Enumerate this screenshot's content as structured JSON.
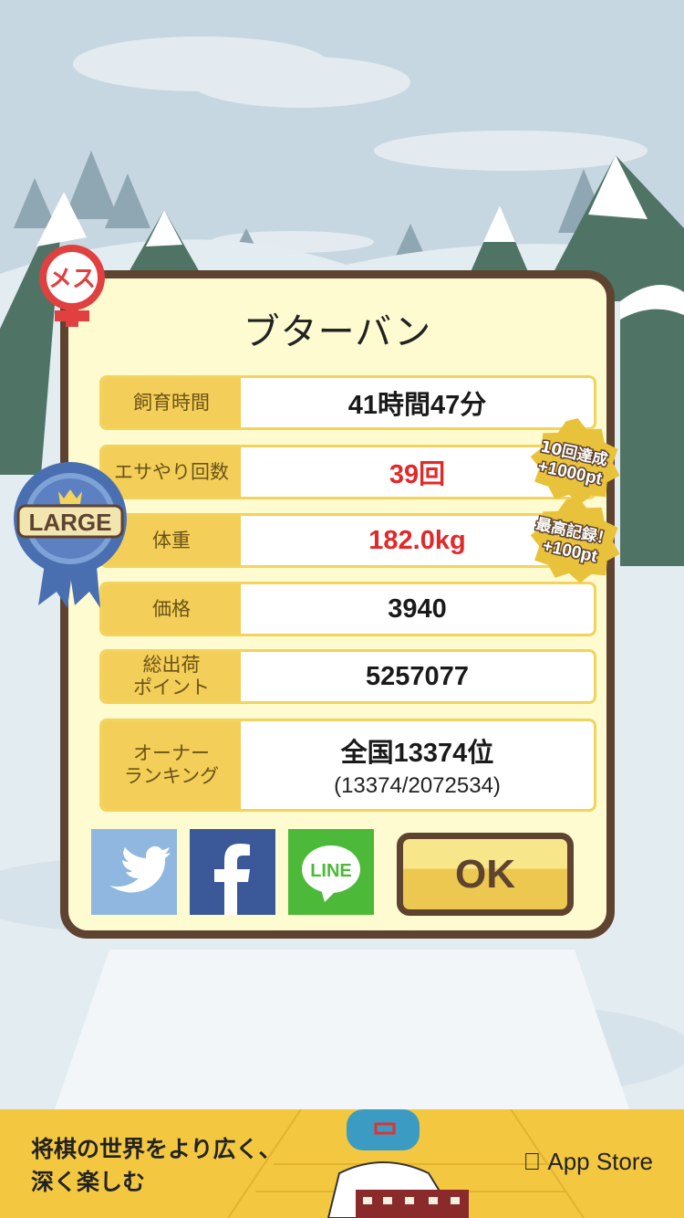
{
  "pig_name": "ブターバン",
  "gender_badge": "メス",
  "size_ribbon": "LARGE",
  "rows": [
    {
      "label": "飼育時間",
      "value": "41時間47分"
    },
    {
      "label": "エサやり回数",
      "value": "39回"
    },
    {
      "label": "体重",
      "value": "182.0kg"
    },
    {
      "label": "価格",
      "value": "3940"
    },
    {
      "label": "総出荷\nポイント",
      "value": "5257077"
    },
    {
      "label": "オーナー\nランキング",
      "value": "全国13374位",
      "sub": "(13374/2072534)"
    }
  ],
  "bonus_badges": [
    {
      "line1": "10回達成",
      "line2": "+1000pt"
    },
    {
      "line1": "最高記録！",
      "line2": "+100pt"
    }
  ],
  "share_buttons": [
    "twitter-icon",
    "facebook-icon",
    "line-icon"
  ],
  "line_label": "LINE",
  "ok_label": "OK",
  "ad": {
    "text": "将棋の世界をより広く、\n深く楽しむ",
    "store": "App Store"
  },
  "colors": {
    "accent_red": "#e22828",
    "label_yellow": "#f3ce58",
    "frame_brown": "#5e4330"
  }
}
